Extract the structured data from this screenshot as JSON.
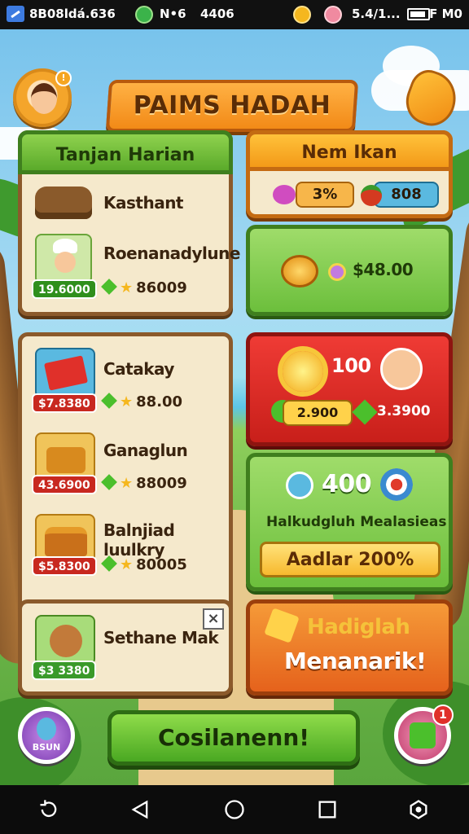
{
  "status_bar": {
    "left_text": "8B08ldá.636",
    "network": "N•6",
    "signal": "4406",
    "battery_text": "5.4/1...",
    "time": "F M0",
    "colors": {
      "app_icon": "#3d7be0",
      "coin_green": "#3bb34a",
      "coin_gold": "#f5b71e",
      "coin_pink": "#f08aa0"
    }
  },
  "header": {
    "title": "PAIMS HADAH",
    "avatar_badge": "!",
    "icons": [
      "avatar-icon",
      "chili-icon"
    ]
  },
  "daily_panel": {
    "title": "Tanjan Harian",
    "items": [
      {
        "name": "Kasthant",
        "icon": "wood-pile-icon"
      },
      {
        "name": "Roenanadylune",
        "price": "19.6000",
        "reward": "86009",
        "icon": "chef-icon"
      }
    ]
  },
  "new_panel": {
    "title": "Nem Ikan",
    "badges": [
      {
        "value": "3%",
        "icon": "candy-icon"
      },
      {
        "value": "808",
        "icon": "tomato-icon"
      }
    ]
  },
  "coin_offer": {
    "price": "$48.00",
    "icons": [
      "coin-stack-icon",
      "coin-small-icon"
    ]
  },
  "shop_panel": {
    "items": [
      {
        "name": "Catakay",
        "price": "$7.8380",
        "reward": "88.00",
        "icon": "red-book-icon"
      },
      {
        "name": "Ganaglun",
        "price": "43.6900",
        "reward": "88009",
        "icon": "treasure-box-icon"
      },
      {
        "name": "Balnjiad luulkry",
        "price": "$5.8300",
        "reward": "80005",
        "icon": "gold-chest-icon"
      }
    ]
  },
  "red_offer": {
    "amount": "100",
    "left_value": "2.900",
    "right_value": "3.3900",
    "icons": [
      "sun-icon",
      "player-portrait-icon",
      "apple-icon",
      "leaf-icon"
    ]
  },
  "green_offer": {
    "amount": "400",
    "subtitle": "Halkudgluh Mealasieas",
    "button": "Aadlar 200%"
  },
  "extra_item": {
    "name": "Sethane Mak",
    "price": "$3 3380",
    "icon": "cookie-icon"
  },
  "orange_offer": {
    "line1": "Hadiglah",
    "line2": "Menanarik!"
  },
  "bottom": {
    "main_button": "Cosilanenn!",
    "left_button": "BSUN",
    "notif_count": "1"
  },
  "nav": [
    "back-icon",
    "home-triangle-icon",
    "home-circle-icon",
    "recents-icon",
    "assistant-icon"
  ]
}
